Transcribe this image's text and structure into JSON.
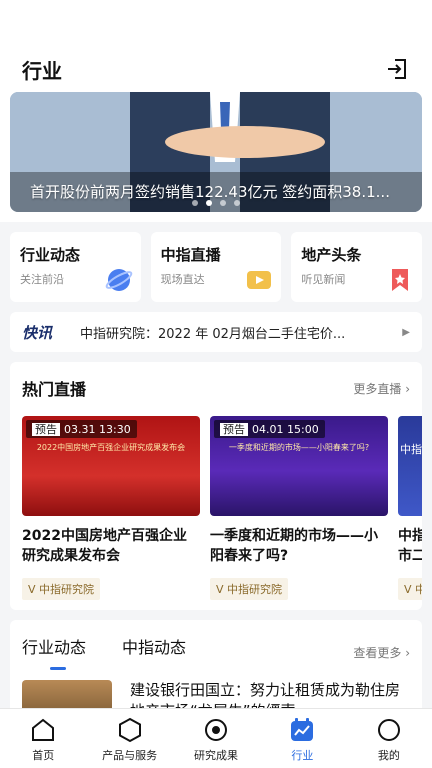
{
  "header": {
    "title": "行业",
    "logout_icon": "logout-icon"
  },
  "banner": {
    "caption": "首开股份前两月签约销售122.43亿元 签约面积38.1...",
    "dots": 4,
    "active_dot": 2
  },
  "quick_links": [
    {
      "title": "行业动态",
      "subtitle": "关注前沿",
      "icon": "planet-icon",
      "color": "#4a7ef0"
    },
    {
      "title": "中指直播",
      "subtitle": "现场直达",
      "icon": "video-icon",
      "color": "#f2c04a"
    },
    {
      "title": "地产头条",
      "subtitle": "听见新闻",
      "icon": "bookmark-icon",
      "color": "#ee5a5a"
    }
  ],
  "news_ticker": {
    "logo": "快讯",
    "text": "中指研究院：2022 年 02月烟台二手住宅价..."
  },
  "hot_live": {
    "title": "热门直播",
    "more": "更多直播",
    "cards": [
      {
        "badge_tag": "预告",
        "badge_time": "03.31 13:30",
        "thumb_text": "2022中国房地产百强企业研究成果发布会",
        "title": "2022中国房地产百强企业研究成果发布会",
        "source": "中指研究院"
      },
      {
        "badge_tag": "预告",
        "badge_time": "04.01 15:00",
        "thumb_text": "一季度和近期的市场——小阳春来了吗?",
        "title": "一季度和近期的市场——小阳春来了吗?",
        "source": "中指研究院"
      },
      {
        "thumb_text": "中指",
        "title": "中指市二",
        "source": "中"
      }
    ]
  },
  "industry_tabs": {
    "tabs": [
      "行业动态",
      "中指动态"
    ],
    "active": 0,
    "more": "查看更多",
    "article_title": "建设银行田国立：努力让租赁成为勒住房地产市场“龙犀牛”的缰索"
  },
  "tabbar": {
    "active": 3,
    "items": [
      {
        "label": "首页",
        "icon": "home-icon"
      },
      {
        "label": "产品与服务",
        "icon": "hexagon-icon"
      },
      {
        "label": "研究成果",
        "icon": "target-icon"
      },
      {
        "label": "行业",
        "icon": "chart-icon"
      },
      {
        "label": "我的",
        "icon": "profile-icon"
      }
    ]
  }
}
